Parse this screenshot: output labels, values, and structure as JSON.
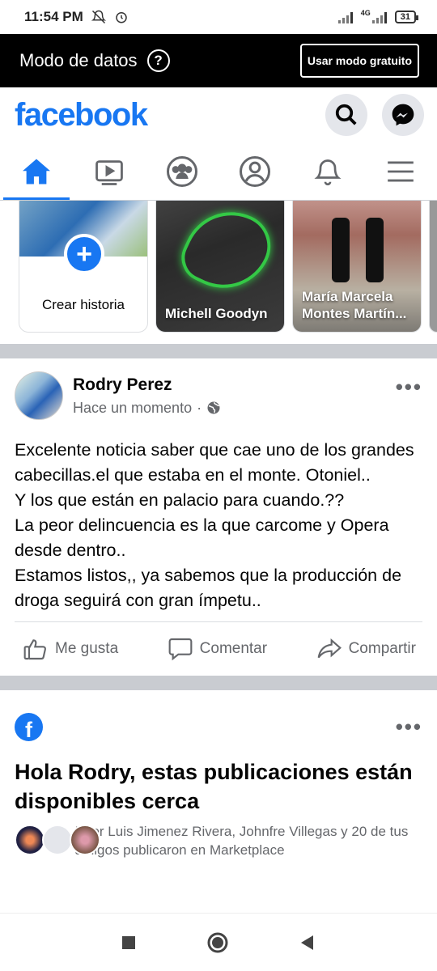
{
  "status": {
    "time": "11:54 PM",
    "network": "4G",
    "battery": "31"
  },
  "data_mode": {
    "label": "Modo de datos",
    "button": "Usar modo gratuito"
  },
  "header": {
    "logo": "facebook"
  },
  "stories": [
    {
      "name": "Crear historia"
    },
    {
      "name": "Michell Goodyn"
    },
    {
      "name_line1": "María Marcela",
      "name_line2": "Montes Martín..."
    }
  ],
  "post": {
    "author": "Rodry Perez",
    "time": "Hace un momento",
    "body": [
      "Excelente noticia saber que cae uno de los grandes cabecillas.el que estaba en el monte. Otoniel..",
      "Y los que están en palacio para cuando.??",
      "La peor delincuencia es la que carcome y Opera desde dentro..",
      "Estamos listos,, ya sabemos que la producción de droga seguirá con gran ímpetu.."
    ],
    "actions": {
      "like": "Me gusta",
      "comment": "Comentar",
      "share": "Compartir"
    }
  },
  "suggestion": {
    "title": "Hola Rodry, estas publicaciones están disponibles cerca",
    "text": "Eder Luis Jimenez Rivera, Johnfre Villegas y 20 de tus amigos publicaron en Marketplace"
  },
  "colors": {
    "brand": "#1877f2",
    "muted": "#65676b",
    "divider": "#c9ccd1"
  },
  "icons": [
    "bell-mute-icon",
    "alarm-icon",
    "help-icon",
    "search-icon",
    "messenger-icon",
    "home-icon",
    "watch-icon",
    "groups-icon",
    "profile-icon",
    "notifications-icon",
    "menu-icon",
    "globe-icon",
    "like-icon",
    "comment-icon",
    "share-icon"
  ]
}
